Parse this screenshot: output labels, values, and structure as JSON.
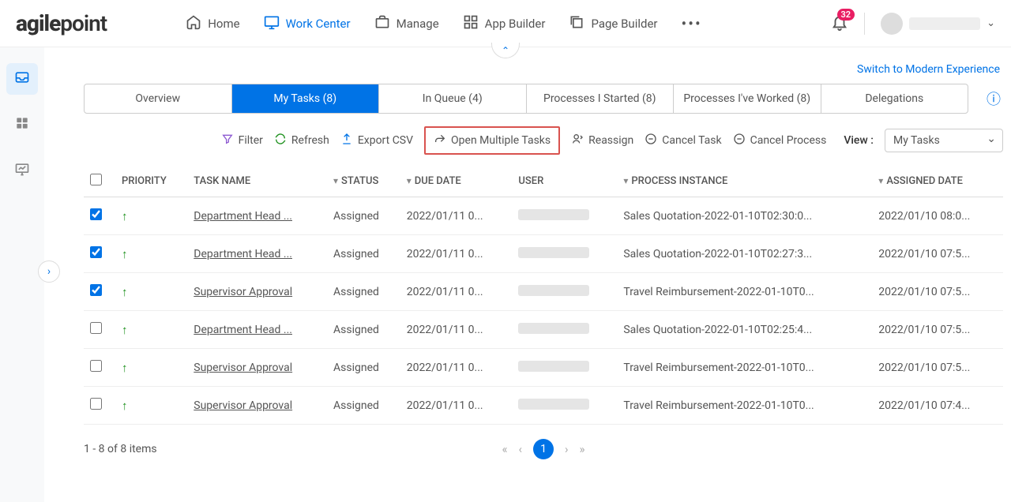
{
  "brand": "agilepoint",
  "nav": {
    "home": "Home",
    "work_center": "Work Center",
    "manage": "Manage",
    "app_builder": "App Builder",
    "page_builder": "Page Builder"
  },
  "notifications": {
    "count": "32"
  },
  "switch_link": "Switch to Modern Experience",
  "tabs": {
    "overview": "Overview",
    "my_tasks": "My Tasks (8)",
    "in_queue": "In Queue (4)",
    "processes_started": "Processes I Started (8)",
    "processes_worked": "Processes I've Worked (8)",
    "delegations": "Delegations"
  },
  "toolbar": {
    "filter": "Filter",
    "refresh": "Refresh",
    "export_csv": "Export CSV",
    "open_multiple": "Open Multiple Tasks",
    "reassign": "Reassign",
    "cancel_task": "Cancel Task",
    "cancel_process": "Cancel Process",
    "view_label": "View :",
    "view_value": "My Tasks"
  },
  "columns": {
    "priority": "PRIORITY",
    "task_name": "TASK NAME",
    "status": "STATUS",
    "due_date": "DUE DATE",
    "user": "USER",
    "process_instance": "PROCESS INSTANCE",
    "assigned_date": "ASSIGNED DATE"
  },
  "rows": [
    {
      "checked": true,
      "task": "Department Head ...",
      "status": "Assigned",
      "due": "2022/01/11 0...",
      "process": "Sales Quotation-2022-01-10T02:30:0...",
      "assigned": "2022/01/10 08:0..."
    },
    {
      "checked": true,
      "task": "Department Head ...",
      "status": "Assigned",
      "due": "2022/01/11 0...",
      "process": "Sales Quotation-2022-01-10T02:27:3...",
      "assigned": "2022/01/10 07:5..."
    },
    {
      "checked": true,
      "task": "Supervisor Approval",
      "status": "Assigned",
      "due": "2022/01/11 0...",
      "process": "Travel Reimbursement-2022-01-10T0...",
      "assigned": "2022/01/10 07:5..."
    },
    {
      "checked": false,
      "task": "Department Head ...",
      "status": "Assigned",
      "due": "2022/01/11 0...",
      "process": "Sales Quotation-2022-01-10T02:25:4...",
      "assigned": "2022/01/10 07:5..."
    },
    {
      "checked": false,
      "task": "Supervisor Approval",
      "status": "Assigned",
      "due": "2022/01/11 0...",
      "process": "Travel Reimbursement-2022-01-10T0...",
      "assigned": "2022/01/10 07:5..."
    },
    {
      "checked": false,
      "task": "Supervisor Approval",
      "status": "Assigned",
      "due": "2022/01/11 0...",
      "process": "Travel Reimbursement-2022-01-10T0...",
      "assigned": "2022/01/10 07:4..."
    }
  ],
  "pager": {
    "info": "1 - 8 of 8 items",
    "page": "1"
  }
}
